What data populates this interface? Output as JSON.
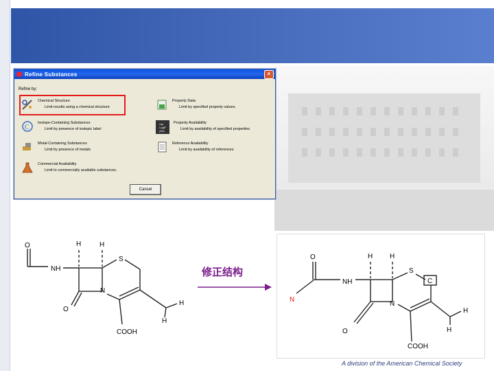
{
  "dialog": {
    "title": "Refine Substances",
    "refine_by": "Refine by:",
    "options": [
      {
        "label": "Chemical Structure",
        "desc": "Limit results using a chemical structure"
      },
      {
        "label": "Isotope-Containing Substances",
        "desc": "Limit by presence of isotopic label"
      },
      {
        "label": "Metal-Containing Substances",
        "desc": "Limit by presence of metals"
      },
      {
        "label": "Commercial Availability",
        "desc": "Limit to commercially available substances."
      },
      {
        "label": "Property Data",
        "desc": "Limit by specified property values."
      },
      {
        "label": "Property Availability",
        "desc": "Limit by availability of specified properties"
      },
      {
        "label": "Reference Availability",
        "desc": "Limit by availability of references"
      }
    ],
    "cancel_label": "Cancel",
    "close_glyph": "×",
    "property_icon_text": "mp\nLogP\npKa"
  },
  "molecule_left": {
    "labels": {
      "o_top": "O",
      "h1": "H",
      "h2": "H",
      "nh": "NH",
      "s": "S",
      "n": "N",
      "o_low": "O",
      "h3": "H",
      "h4": "H",
      "cooh": "COOH"
    }
  },
  "arrow_label": "修正结构",
  "molecule_right": {
    "labels": {
      "o_top": "O",
      "h1": "H",
      "h2": "H",
      "nh": "NH",
      "s": "S",
      "c": "C",
      "n_red": "N",
      "n": "N",
      "o_low": "O",
      "h3": "H",
      "h4": "H",
      "cooh": "COOH"
    }
  },
  "footer": "A division of the American Chemical Society",
  "colors": {
    "header": "#2f55a8",
    "highlight": "#e31b1b",
    "arrow": "#7a1f8a"
  }
}
